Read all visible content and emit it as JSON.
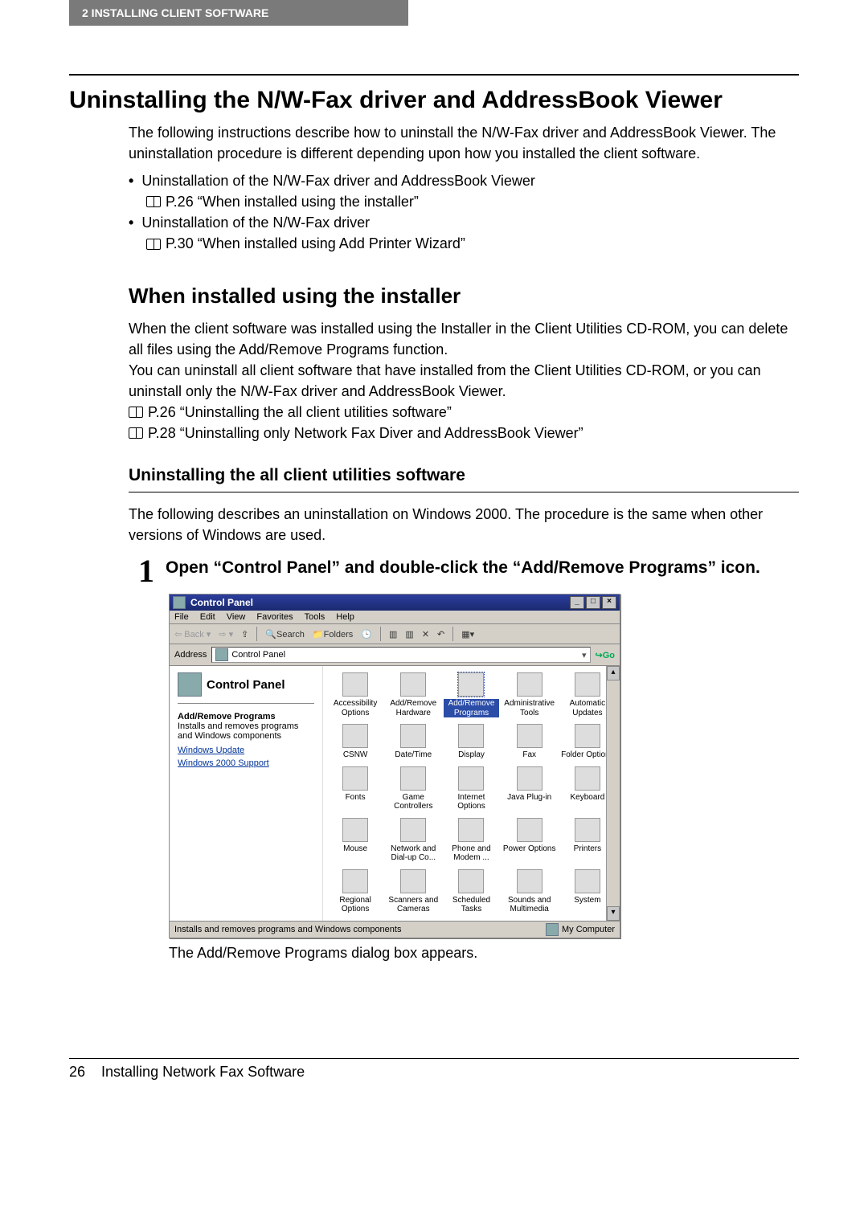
{
  "header": {
    "chapter": "2   INSTALLING CLIENT SOFTWARE"
  },
  "h1": "Uninstalling the N/W-Fax driver and AddressBook Viewer",
  "intro": "The following instructions describe how to uninstall the N/W-Fax driver and AddressBook Viewer. The uninstallation procedure is different depending upon how you installed the client software.",
  "bullets": [
    {
      "text": "Uninstallation of the N/W-Fax driver and AddressBook Viewer",
      "ref": "P.26 “When installed using the installer”"
    },
    {
      "text": "Uninstallation of the N/W-Fax driver",
      "ref": "P.30 “When installed using Add Printer Wizard”"
    }
  ],
  "h2": "When installed using the installer",
  "body2a": "When the client software was installed using the Installer in the Client Utilities CD-ROM, you can delete all files using the Add/Remove Programs function.",
  "body2b": "You can uninstall all client software that have installed from the Client Utilities CD-ROM, or you can uninstall only the N/W-Fax driver and AddressBook Viewer.",
  "refs2": [
    "P.26 “Uninstalling the all client utilities software”",
    "P.28 “Uninstalling only Network Fax Diver and AddressBook Viewer”"
  ],
  "h3": "Uninstalling the all client utilities software",
  "body3": "The following describes an uninstallation on Windows 2000. The procedure is the same when other versions of Windows are used.",
  "step": {
    "num": "1",
    "text": "Open “Control Panel” and double-click the “Add/Remove Programs” icon."
  },
  "screenshot": {
    "title": "Control Panel",
    "menu": [
      "File",
      "Edit",
      "View",
      "Favorites",
      "Tools",
      "Help"
    ],
    "toolbar": {
      "back": "Back",
      "search": "Search",
      "folders": "Folders"
    },
    "address_label": "Address",
    "address_value": "Control Panel",
    "go": "Go",
    "left": {
      "title": "Control Panel",
      "bold": "Add/Remove Programs",
      "desc": "Installs and removes programs and Windows components",
      "links": [
        "Windows Update",
        "Windows 2000 Support"
      ]
    },
    "icons": [
      "Accessibility Options",
      "Add/Remove Hardware",
      "Add/Remove Programs",
      "Administrative Tools",
      "Automatic Updates",
      "CSNW",
      "Date/Time",
      "Display",
      "Fax",
      "Folder Options",
      "Fonts",
      "Game Controllers",
      "Internet Options",
      "Java Plug-in",
      "Keyboard",
      "Mouse",
      "Network and Dial-up Co...",
      "Phone and Modem ...",
      "Power Options",
      "Printers",
      "Regional Options",
      "Scanners and Cameras",
      "Scheduled Tasks",
      "Sounds and Multimedia",
      "System"
    ],
    "selected_index": 2,
    "status_left": "Installs and removes programs and Windows components",
    "status_right": "My Computer"
  },
  "caption": "The Add/Remove Programs dialog box appears.",
  "footer": {
    "page": "26",
    "title": "Installing Network Fax Software"
  }
}
